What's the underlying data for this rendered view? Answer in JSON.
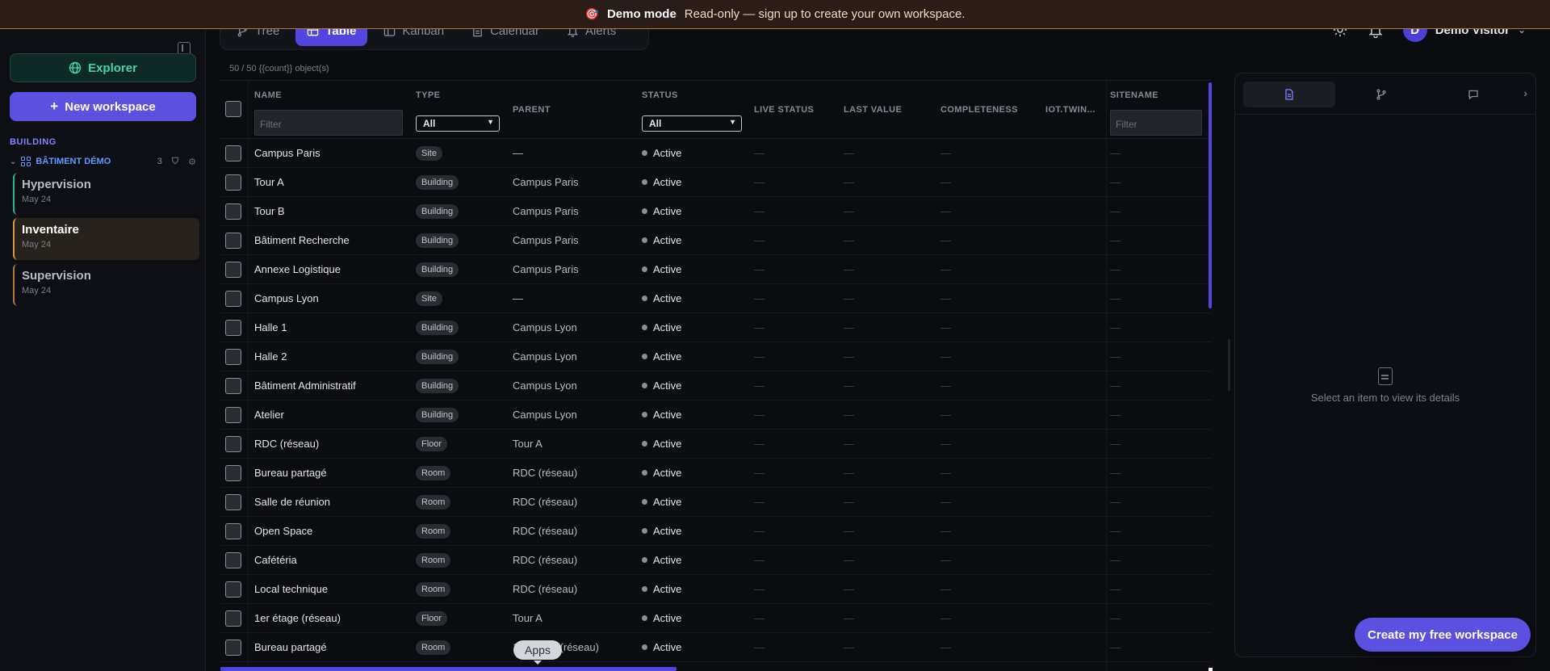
{
  "banner": {
    "emoji": "🎯",
    "title": "Demo mode",
    "message": "Read-only — sign up to create your own workspace."
  },
  "sidebar": {
    "explorer_label": "Explorer",
    "new_workspace_label": "New workspace",
    "section_label": "BUILDING",
    "group": {
      "name": "BÂTIMENT DÉMO",
      "count": "3"
    },
    "workspaces": [
      {
        "name": "Hypervision",
        "date": "May 24"
      },
      {
        "name": "Inventaire",
        "date": "May 24"
      },
      {
        "name": "Supervision",
        "date": "May 24"
      }
    ]
  },
  "tabs": [
    {
      "label": "Tree",
      "icon": "tree-icon"
    },
    {
      "label": "Table",
      "icon": "table-icon"
    },
    {
      "label": "Kanban",
      "icon": "kanban-icon"
    },
    {
      "label": "Calendar",
      "icon": "calendar-icon"
    },
    {
      "label": "Alerts",
      "icon": "bell-icon"
    }
  ],
  "user": {
    "initial": "D",
    "name": "Demo Visitor"
  },
  "count_text": "50 / 50 {{count}} object(s)",
  "table": {
    "headers": {
      "name": "NAME",
      "type": "TYPE",
      "parent": "PARENT",
      "status": "STATUS",
      "live_status": "LIVE STATUS",
      "last_value": "LAST VALUE",
      "completeness": "COMPLETENESS",
      "iot_twin": "IOT.TWIN...",
      "sitename": "SITENAME"
    },
    "filter_placeholder": "Filter",
    "type_select": "All",
    "status_select": "All",
    "empty_value": "—",
    "rows": [
      {
        "name": "Campus Paris",
        "type": "Site",
        "parent": "—",
        "status": "Active"
      },
      {
        "name": "Tour A",
        "type": "Building",
        "parent": "Campus Paris",
        "status": "Active"
      },
      {
        "name": "Tour B",
        "type": "Building",
        "parent": "Campus Paris",
        "status": "Active"
      },
      {
        "name": "Bâtiment Recherche",
        "type": "Building",
        "parent": "Campus Paris",
        "status": "Active"
      },
      {
        "name": "Annexe Logistique",
        "type": "Building",
        "parent": "Campus Paris",
        "status": "Active"
      },
      {
        "name": "Campus Lyon",
        "type": "Site",
        "parent": "—",
        "status": "Active"
      },
      {
        "name": "Halle 1",
        "type": "Building",
        "parent": "Campus Lyon",
        "status": "Active"
      },
      {
        "name": "Halle 2",
        "type": "Building",
        "parent": "Campus Lyon",
        "status": "Active"
      },
      {
        "name": "Bâtiment Administratif",
        "type": "Building",
        "parent": "Campus Lyon",
        "status": "Active"
      },
      {
        "name": "Atelier",
        "type": "Building",
        "parent": "Campus Lyon",
        "status": "Active"
      },
      {
        "name": "RDC (réseau)",
        "type": "Floor",
        "parent": "Tour A",
        "status": "Active"
      },
      {
        "name": "Bureau partagé",
        "type": "Room",
        "parent": "RDC (réseau)",
        "status": "Active"
      },
      {
        "name": "Salle de réunion",
        "type": "Room",
        "parent": "RDC (réseau)",
        "status": "Active"
      },
      {
        "name": "Open Space",
        "type": "Room",
        "parent": "RDC (réseau)",
        "status": "Active"
      },
      {
        "name": "Cafétéria",
        "type": "Room",
        "parent": "RDC (réseau)",
        "status": "Active"
      },
      {
        "name": "Local technique",
        "type": "Room",
        "parent": "RDC (réseau)",
        "status": "Active"
      },
      {
        "name": "1er étage (réseau)",
        "type": "Floor",
        "parent": "Tour A",
        "status": "Active"
      },
      {
        "name": "Bureau partagé",
        "type": "Room",
        "parent": "1er étage (réseau)",
        "status": "Active"
      }
    ]
  },
  "tooltip": "Apps",
  "detail_panel": {
    "empty_text": "Select an item to view its details"
  },
  "cta_label": "Create my free workspace",
  "colors": {
    "accent": "#5147e0",
    "banner_bg": "#2a1c16",
    "explorer": "#43d3a6"
  }
}
